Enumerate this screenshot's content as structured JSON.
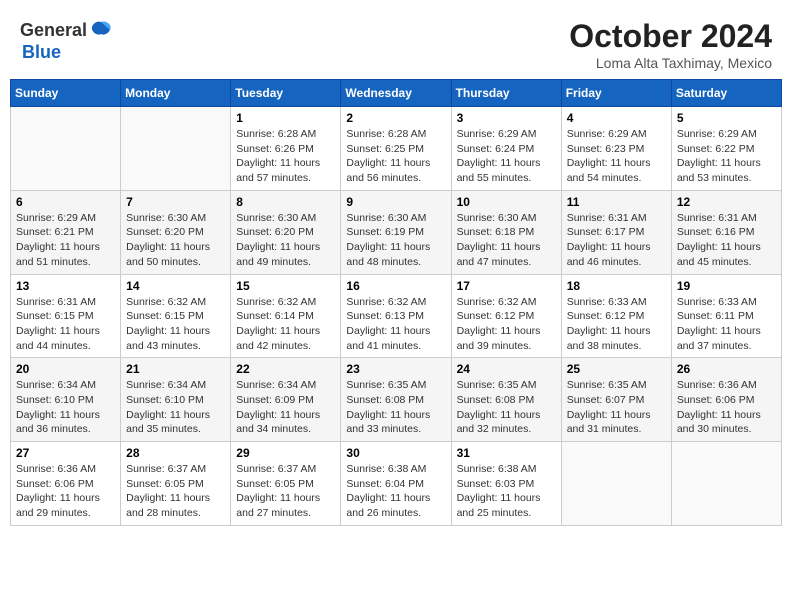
{
  "header": {
    "logo_general": "General",
    "logo_blue": "Blue",
    "month_title": "October 2024",
    "location": "Loma Alta Taxhimay, Mexico"
  },
  "weekdays": [
    "Sunday",
    "Monday",
    "Tuesday",
    "Wednesday",
    "Thursday",
    "Friday",
    "Saturday"
  ],
  "weeks": [
    [
      {
        "day": "",
        "info": ""
      },
      {
        "day": "",
        "info": ""
      },
      {
        "day": "1",
        "info": "Sunrise: 6:28 AM\nSunset: 6:26 PM\nDaylight: 11 hours\nand 57 minutes."
      },
      {
        "day": "2",
        "info": "Sunrise: 6:28 AM\nSunset: 6:25 PM\nDaylight: 11 hours\nand 56 minutes."
      },
      {
        "day": "3",
        "info": "Sunrise: 6:29 AM\nSunset: 6:24 PM\nDaylight: 11 hours\nand 55 minutes."
      },
      {
        "day": "4",
        "info": "Sunrise: 6:29 AM\nSunset: 6:23 PM\nDaylight: 11 hours\nand 54 minutes."
      },
      {
        "day": "5",
        "info": "Sunrise: 6:29 AM\nSunset: 6:22 PM\nDaylight: 11 hours\nand 53 minutes."
      }
    ],
    [
      {
        "day": "6",
        "info": "Sunrise: 6:29 AM\nSunset: 6:21 PM\nDaylight: 11 hours\nand 51 minutes."
      },
      {
        "day": "7",
        "info": "Sunrise: 6:30 AM\nSunset: 6:20 PM\nDaylight: 11 hours\nand 50 minutes."
      },
      {
        "day": "8",
        "info": "Sunrise: 6:30 AM\nSunset: 6:20 PM\nDaylight: 11 hours\nand 49 minutes."
      },
      {
        "day": "9",
        "info": "Sunrise: 6:30 AM\nSunset: 6:19 PM\nDaylight: 11 hours\nand 48 minutes."
      },
      {
        "day": "10",
        "info": "Sunrise: 6:30 AM\nSunset: 6:18 PM\nDaylight: 11 hours\nand 47 minutes."
      },
      {
        "day": "11",
        "info": "Sunrise: 6:31 AM\nSunset: 6:17 PM\nDaylight: 11 hours\nand 46 minutes."
      },
      {
        "day": "12",
        "info": "Sunrise: 6:31 AM\nSunset: 6:16 PM\nDaylight: 11 hours\nand 45 minutes."
      }
    ],
    [
      {
        "day": "13",
        "info": "Sunrise: 6:31 AM\nSunset: 6:15 PM\nDaylight: 11 hours\nand 44 minutes."
      },
      {
        "day": "14",
        "info": "Sunrise: 6:32 AM\nSunset: 6:15 PM\nDaylight: 11 hours\nand 43 minutes."
      },
      {
        "day": "15",
        "info": "Sunrise: 6:32 AM\nSunset: 6:14 PM\nDaylight: 11 hours\nand 42 minutes."
      },
      {
        "day": "16",
        "info": "Sunrise: 6:32 AM\nSunset: 6:13 PM\nDaylight: 11 hours\nand 41 minutes."
      },
      {
        "day": "17",
        "info": "Sunrise: 6:32 AM\nSunset: 6:12 PM\nDaylight: 11 hours\nand 39 minutes."
      },
      {
        "day": "18",
        "info": "Sunrise: 6:33 AM\nSunset: 6:12 PM\nDaylight: 11 hours\nand 38 minutes."
      },
      {
        "day": "19",
        "info": "Sunrise: 6:33 AM\nSunset: 6:11 PM\nDaylight: 11 hours\nand 37 minutes."
      }
    ],
    [
      {
        "day": "20",
        "info": "Sunrise: 6:34 AM\nSunset: 6:10 PM\nDaylight: 11 hours\nand 36 minutes."
      },
      {
        "day": "21",
        "info": "Sunrise: 6:34 AM\nSunset: 6:10 PM\nDaylight: 11 hours\nand 35 minutes."
      },
      {
        "day": "22",
        "info": "Sunrise: 6:34 AM\nSunset: 6:09 PM\nDaylight: 11 hours\nand 34 minutes."
      },
      {
        "day": "23",
        "info": "Sunrise: 6:35 AM\nSunset: 6:08 PM\nDaylight: 11 hours\nand 33 minutes."
      },
      {
        "day": "24",
        "info": "Sunrise: 6:35 AM\nSunset: 6:08 PM\nDaylight: 11 hours\nand 32 minutes."
      },
      {
        "day": "25",
        "info": "Sunrise: 6:35 AM\nSunset: 6:07 PM\nDaylight: 11 hours\nand 31 minutes."
      },
      {
        "day": "26",
        "info": "Sunrise: 6:36 AM\nSunset: 6:06 PM\nDaylight: 11 hours\nand 30 minutes."
      }
    ],
    [
      {
        "day": "27",
        "info": "Sunrise: 6:36 AM\nSunset: 6:06 PM\nDaylight: 11 hours\nand 29 minutes."
      },
      {
        "day": "28",
        "info": "Sunrise: 6:37 AM\nSunset: 6:05 PM\nDaylight: 11 hours\nand 28 minutes."
      },
      {
        "day": "29",
        "info": "Sunrise: 6:37 AM\nSunset: 6:05 PM\nDaylight: 11 hours\nand 27 minutes."
      },
      {
        "day": "30",
        "info": "Sunrise: 6:38 AM\nSunset: 6:04 PM\nDaylight: 11 hours\nand 26 minutes."
      },
      {
        "day": "31",
        "info": "Sunrise: 6:38 AM\nSunset: 6:03 PM\nDaylight: 11 hours\nand 25 minutes."
      },
      {
        "day": "",
        "info": ""
      },
      {
        "day": "",
        "info": ""
      }
    ]
  ]
}
